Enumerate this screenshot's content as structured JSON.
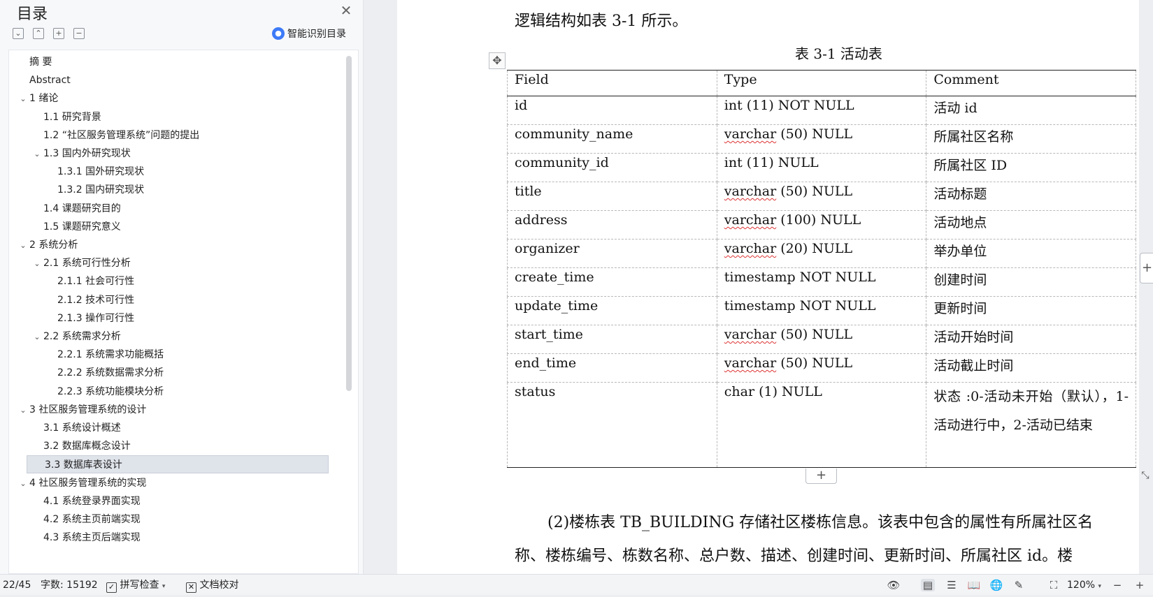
{
  "toc": {
    "title": "目录",
    "smart_label": "智能识别目录",
    "items": [
      {
        "label": "摘    要",
        "level": 0,
        "chevron": false
      },
      {
        "label": "Abstract",
        "level": 0,
        "chevron": false
      },
      {
        "label": "1  绪论",
        "level": 0,
        "chevron": true
      },
      {
        "label": "1.1  研究背景",
        "level": 1,
        "chevron": false
      },
      {
        "label": "1.2  “社区服务管理系统”问题的提出",
        "level": 1,
        "chevron": false
      },
      {
        "label": "1.3  国内外研究现状",
        "level": 1,
        "chevron": true
      },
      {
        "label": "1.3.1  国外研究现状",
        "level": 2,
        "chevron": false
      },
      {
        "label": "1.3.2  国内研究现状",
        "level": 2,
        "chevron": false
      },
      {
        "label": "1.4  课题研究目的",
        "level": 1,
        "chevron": false
      },
      {
        "label": "1.5  课题研究意义",
        "level": 1,
        "chevron": false
      },
      {
        "label": "2  系统分析",
        "level": 0,
        "chevron": true
      },
      {
        "label": "2.1  系统可行性分析",
        "level": 1,
        "chevron": true
      },
      {
        "label": "2.1.1  社会可行性",
        "level": 2,
        "chevron": false
      },
      {
        "label": "2.1.2  技术可行性",
        "level": 2,
        "chevron": false
      },
      {
        "label": "2.1.3  操作可行性",
        "level": 2,
        "chevron": false
      },
      {
        "label": "2.2  系统需求分析",
        "level": 1,
        "chevron": true
      },
      {
        "label": "2.2.1  系统需求功能概括",
        "level": 2,
        "chevron": false
      },
      {
        "label": "2.2.2  系统数据需求分析",
        "level": 2,
        "chevron": false
      },
      {
        "label": "2.2.3  系统功能模块分析",
        "level": 2,
        "chevron": false
      },
      {
        "label": "3  社区服务管理系统的设计",
        "level": 0,
        "chevron": true
      },
      {
        "label": "3.1  系统设计概述",
        "level": 1,
        "chevron": false
      },
      {
        "label": "3.2  数据库概念设计",
        "level": 1,
        "chevron": false
      },
      {
        "label": "3.3  数据库表设计",
        "level": 1,
        "chevron": false,
        "selected": true
      },
      {
        "label": "4  社区服务管理系统的实现",
        "level": 0,
        "chevron": true
      },
      {
        "label": "4.1  系统登录界面实现",
        "level": 1,
        "chevron": false
      },
      {
        "label": "4.2  系统主页前端实现",
        "level": 1,
        "chevron": false
      },
      {
        "label": "4.3  系统主页后端实现",
        "level": 1,
        "chevron": false
      }
    ]
  },
  "document": {
    "intro_line": "逻辑结构如表 3-1 所示。",
    "table_caption": "表 3-1  活动表",
    "table": {
      "headers": [
        "Field",
        "Type",
        "Comment"
      ],
      "rows": [
        {
          "field": "id",
          "type_word": "int",
          "type_rest": " (11) NOT NULL",
          "comment": "活动 id",
          "squiggle": false
        },
        {
          "field": "community_name",
          "type_word": "varchar",
          "type_rest": " (50) NULL",
          "comment": "所属社区名称",
          "squiggle": true
        },
        {
          "field": "community_id",
          "type_word": "int",
          "type_rest": " (11) NULL",
          "comment": "所属社区 ID",
          "squiggle": false
        },
        {
          "field": "title",
          "type_word": "varchar",
          "type_rest": " (50) NULL",
          "comment": "活动标题",
          "squiggle": true
        },
        {
          "field": "address",
          "type_word": "varchar",
          "type_rest": " (100) NULL",
          "comment": "活动地点",
          "squiggle": true
        },
        {
          "field": "organizer",
          "type_word": "varchar",
          "type_rest": " (20) NULL",
          "comment": "举办单位",
          "squiggle": true
        },
        {
          "field": "create_time",
          "type_word": "timestamp",
          "type_rest": " NOT NULL",
          "comment": "创建时间",
          "squiggle": false
        },
        {
          "field": "update_time",
          "type_word": "timestamp",
          "type_rest": " NOT NULL",
          "comment": "更新时间",
          "squiggle": false
        },
        {
          "field": "start_time",
          "type_word": "varchar",
          "type_rest": " (50) NULL",
          "comment": "活动开始时间",
          "squiggle": true
        },
        {
          "field": "end_time",
          "type_word": "varchar",
          "type_rest": " (50) NULL",
          "comment": "活动截止时间",
          "squiggle": true
        },
        {
          "field": "status",
          "type_word": "char",
          "type_rest": " (1) NULL",
          "comment": "状态 :0-活动未开始（默认），1-活动进行中，2-活动已结束",
          "squiggle": false
        }
      ]
    },
    "para_line1": "(2)楼栋表 TB_BUILDING 存储社区楼栋信息。该表中包含的属性有所属社区名",
    "para_line2": "称、楼栋编号、栋数名称、总户数、描述、创建时间、更新时间、所属社区 id。楼"
  },
  "status_bar": {
    "page": "22/45",
    "word_count": "字数: 15192",
    "spell_check": "拼写检查",
    "doc_proof": "文档校对",
    "zoom": "120%"
  }
}
